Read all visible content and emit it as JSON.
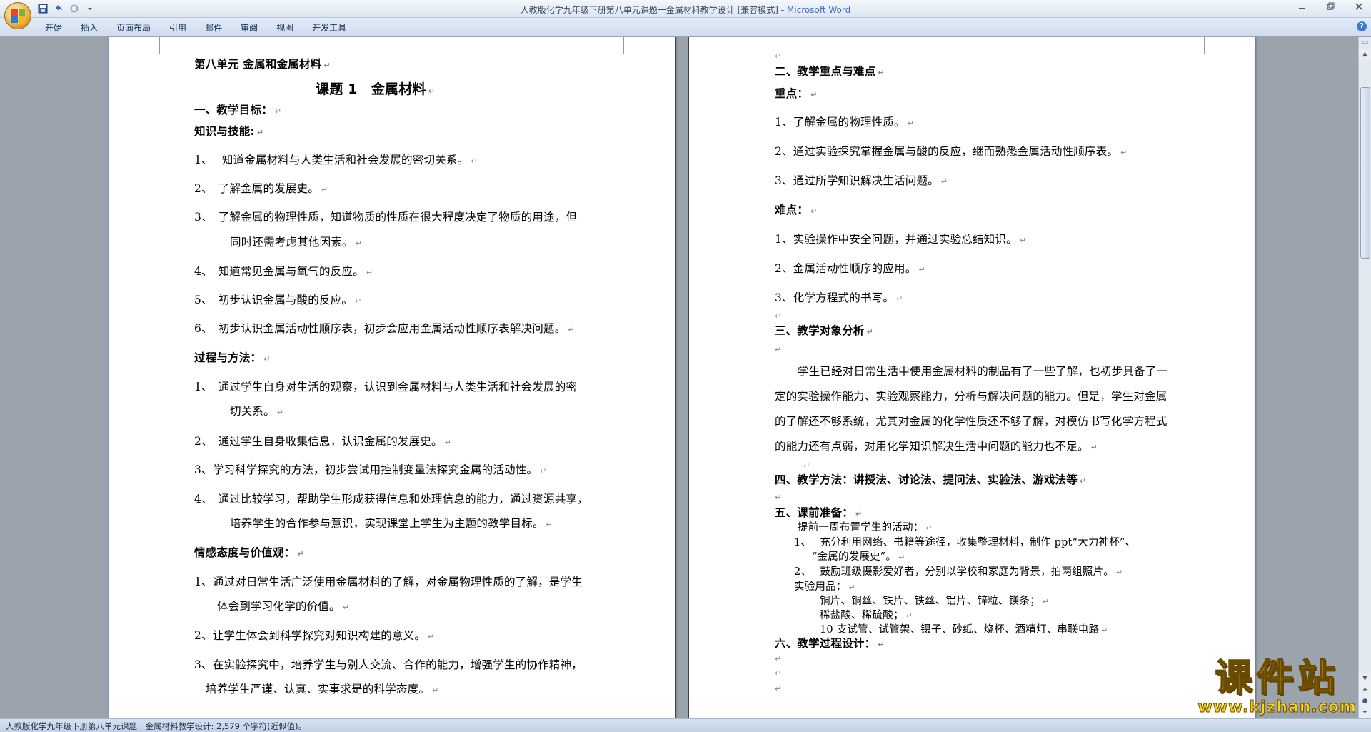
{
  "window": {
    "title": "人教版化学九年级下册第八单元课题一金属材料教学设计 [兼容模式] - ",
    "app_name": "Microsoft Word"
  },
  "ribbon": {
    "tabs": [
      "开始",
      "插入",
      "页面布局",
      "引用",
      "邮件",
      "审阅",
      "视图",
      "开发工具"
    ]
  },
  "statusbar": {
    "text": "人教版化学九年级下册第八单元课题一金属材料教学设计: 2,579 个字符(近似值)。"
  },
  "left_page": {
    "unit_heading": "第八单元 金属和金属材料",
    "lesson_title": "课题 1　金属材料",
    "sec1": "一、教学目标：",
    "knowledge_heading": "知识与技能:",
    "k1": "1、　 知道金属材料与人类生活和社会发展的密切关系。",
    "k2": "2、　了解金属的发展史。",
    "k3a": "3、　了解金属的物理性质，知道物质的性质在很大程度决定了物质的用途，但",
    "k3b": "同时还需考虑其他因素。",
    "k4": "4、　知道常见金属与氧气的反应。",
    "k5": "5、　初步认识金属与酸的反应。",
    "k6": "6、　初步认识金属活动性顺序表，初步会应用金属活动性顺序表解决问题。",
    "process_heading": "过程与方法：",
    "p1a": "1、　通过学生自身对生活的观察，认识到金属材料与人类生活和社会发展的密",
    "p1b": "切关系。",
    "p2": "2、　通过学生自身收集信息，认识金属的发展史。",
    "p3": "3、学习科学探究的方法，初步尝试用控制变量法探究金属的活动性。",
    "p4a": "4、　通过比较学习，帮助学生形成获得信息和处理信息的能力，通过资源共享，",
    "p4b": "培养学生的合作参与意识，实现课堂上学生为主题的教学目标。",
    "emotion_heading": "情感态度与价值观：",
    "e1a": "1、通过对日常生活广泛使用金属材料的了解，对金属物理性质的了解，是学生",
    "e1b": "体会到学习化学的价值。",
    "e2": "2、让学生体会到科学探究对知识构建的意义。",
    "e3a": "3、在实验探究中，培养学生与别人交流、合作的能力，增强学生的协作精神，",
    "e3b": "培养学生严谨、认真、实事求是的科学态度。"
  },
  "right_page": {
    "sec2": "二、教学重点与难点",
    "key_heading": "重点：",
    "key1": "1、了解金属的物理性质。",
    "key2": "2、通过实验探究掌握金属与酸的反应，继而熟悉金属活动性顺序表。",
    "key3": "3、通过所学知识解决生活问题。",
    "diff_heading": "难点：",
    "d1": "1、实验操作中安全问题，并通过实验总结知识。",
    "d2": "2、金属活动性顺序的应用。",
    "d3": "3、化学方程式的书写。",
    "sec3": "三、教学对象分析",
    "a1": "学生已经对日常生活中使用金属材料的制品有了一些了解，也初步具备了一",
    "a2": "定的实验操作能力、实验观察能力，分析与解决问题的能力。但是，学生对金属",
    "a3": "的了解还不够系统，尤其对金属的化学性质还不够了解，对模仿书写化学方程式",
    "a4": "的能力还有点弱，对用化学知识解决生活中问题的能力也不足。",
    "sec4": "四、教学方法：讲授法、讨论法、提问法、实验法、游戏法等",
    "sec5": "五、课前准备：",
    "prep_intro": "提前一周布置学生的活动：",
    "prep1a": "1、　 充分利用网络、书籍等途径，收集整理材料，制作 ppt“大力神杯”、",
    "prep1b": "“金属的发展史”。",
    "prep2": "2、　 鼓励班级摄影爱好者，分别以学校和家庭为背景，拍两组照片。",
    "supplies_heading": "实验用品：",
    "s1": "铜片、铜丝、铁片、铁丝、铝片、锌粒、镁条；",
    "s2": "稀盐酸、稀硫酸；",
    "s3": "10 支试管、试管架、镊子、砂纸、烧杯、酒精灯、串联电路",
    "sec6": "六、教学过程设计："
  },
  "marks": {
    "paragraph": "↵"
  },
  "watermark": {
    "text": "课件站",
    "url": "www.kjzhan.com"
  }
}
